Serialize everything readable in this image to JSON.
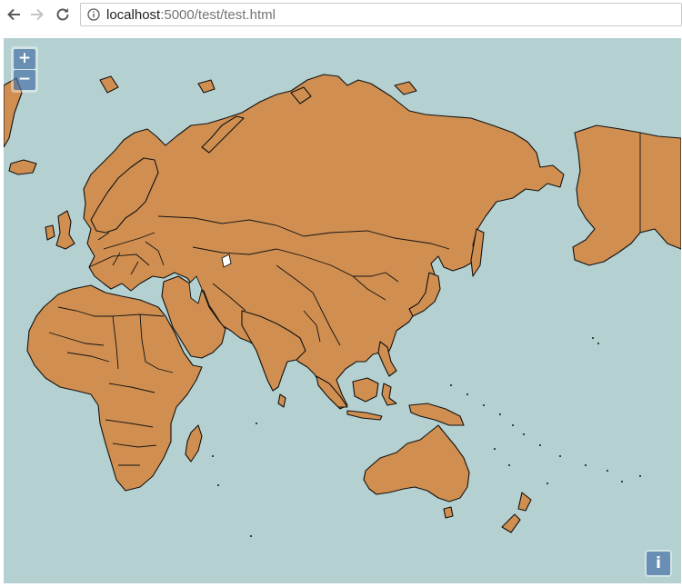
{
  "browser": {
    "back_icon": "arrow-left-icon",
    "forward_icon": "arrow-right-icon",
    "reload_icon": "reload-icon",
    "info_icon": "info-circle-icon",
    "url_host": "localhost",
    "url_rest": ":5000/test/test.html"
  },
  "map": {
    "zoom_in_label": "+",
    "zoom_out_label": "−",
    "attribution_label": "i",
    "colors": {
      "ocean": "#b5d0d0",
      "land": "#d08f51",
      "borders": "#111111",
      "control": "#7b9cc4"
    }
  }
}
